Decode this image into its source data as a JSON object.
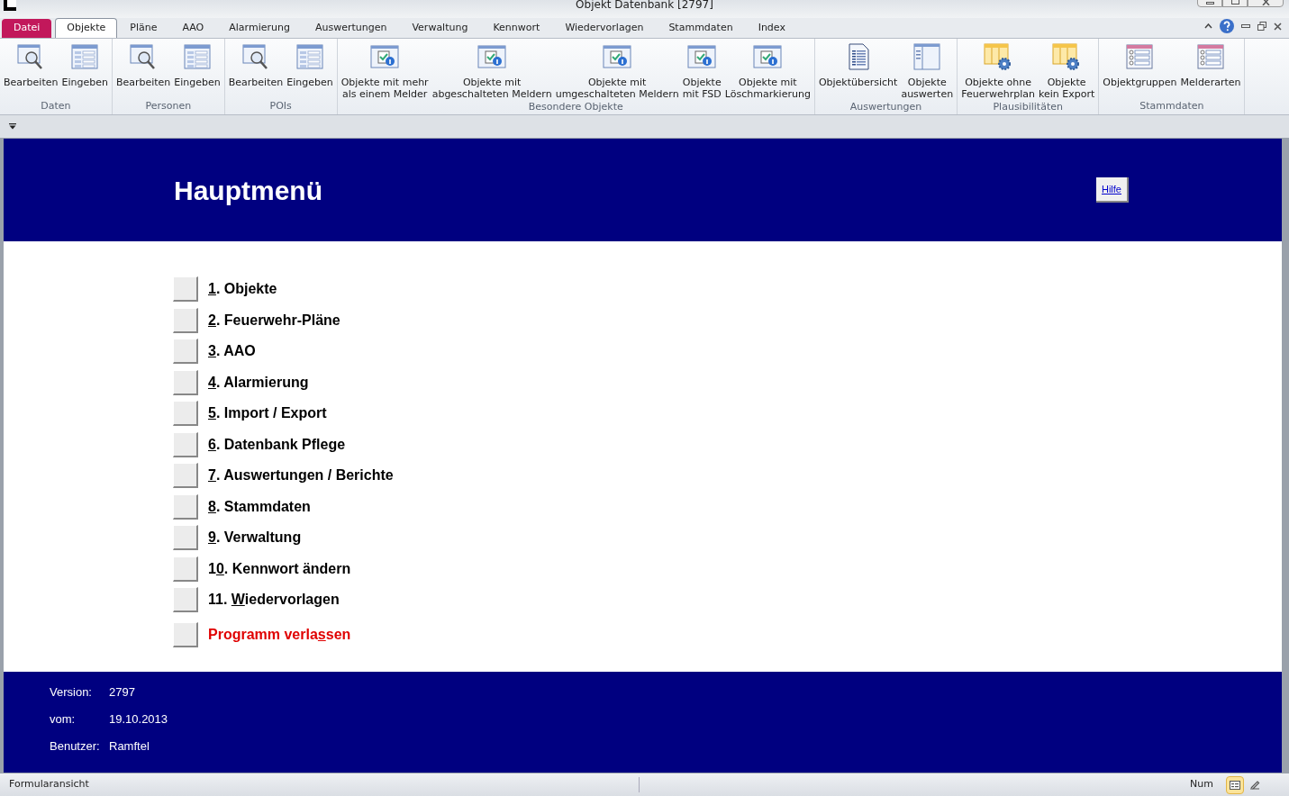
{
  "window": {
    "title": "Objekt Datenbank [2797]"
  },
  "tabs": [
    {
      "label": "Datei",
      "kind": "file"
    },
    {
      "label": "Objekte",
      "kind": "tab",
      "selected": true
    },
    {
      "label": "Pläne",
      "kind": "tab",
      "selected": false
    },
    {
      "label": "AAO",
      "kind": "tab",
      "selected": false
    },
    {
      "label": "Alarmierung",
      "kind": "tab",
      "selected": false
    },
    {
      "label": "Auswertungen",
      "kind": "tab",
      "selected": false
    },
    {
      "label": "Verwaltung",
      "kind": "tab",
      "selected": false
    },
    {
      "label": "Kennwort",
      "kind": "tab",
      "selected": false
    },
    {
      "label": "Wiedervorlagen",
      "kind": "tab",
      "selected": false
    },
    {
      "label": "Stammdaten",
      "kind": "tab",
      "selected": false
    },
    {
      "label": "Index",
      "kind": "tab",
      "selected": false
    }
  ],
  "ribbon": [
    {
      "name": "Daten",
      "buttons": [
        {
          "kind": "search",
          "lines": [
            "Bearbeiten"
          ]
        },
        {
          "kind": "form",
          "lines": [
            "Eingeben"
          ]
        }
      ]
    },
    {
      "name": "Personen",
      "buttons": [
        {
          "kind": "search",
          "lines": [
            "Bearbeiten"
          ]
        },
        {
          "kind": "form",
          "lines": [
            "Eingeben"
          ]
        }
      ]
    },
    {
      "name": "POIs",
      "buttons": [
        {
          "kind": "search",
          "lines": [
            "Bearbeiten"
          ]
        },
        {
          "kind": "form",
          "lines": [
            "Eingeben"
          ]
        }
      ]
    },
    {
      "name": "Besondere Objekte",
      "buttons": [
        {
          "kind": "info",
          "lines": [
            "Objekte mit mehr",
            "als einem Melder"
          ]
        },
        {
          "kind": "info",
          "lines": [
            "Objekte mit",
            "abgeschalteten Meldern"
          ]
        },
        {
          "kind": "info",
          "lines": [
            "Objekte mit",
            "umgeschalteten Meldern"
          ]
        },
        {
          "kind": "info",
          "lines": [
            "Objekte",
            "mit FSD"
          ]
        },
        {
          "kind": "info",
          "lines": [
            "Objekte mit",
            "Löschmarkierung"
          ]
        }
      ]
    },
    {
      "name": "Auswertungen",
      "buttons": [
        {
          "kind": "report",
          "lines": [
            "Objektübersicht"
          ]
        },
        {
          "kind": "panel",
          "lines": [
            "Objekte",
            "auswerten"
          ]
        }
      ]
    },
    {
      "name": "Plausibilitäten",
      "buttons": [
        {
          "kind": "gear",
          "lines": [
            "Objekte ohne",
            "Feuerwehrplan"
          ]
        },
        {
          "kind": "gear",
          "lines": [
            "Objekte",
            "kein Export"
          ]
        }
      ]
    },
    {
      "name": "Stammdaten",
      "buttons": [
        {
          "kind": "people",
          "lines": [
            "Objektgruppen"
          ]
        },
        {
          "kind": "people",
          "lines": [
            "Melderarten"
          ]
        }
      ]
    }
  ],
  "header": {
    "title": "Hauptmenü",
    "help_button": "Hilfe"
  },
  "menu": [
    {
      "key": "1",
      "after": ". Objekte",
      "kind": "normal"
    },
    {
      "key": "2",
      "after": ". Feuerwehr-Pläne",
      "kind": "normal"
    },
    {
      "key": "3",
      "after": ". AAO",
      "kind": "normal"
    },
    {
      "key": "4",
      "after": ". Alarmierung",
      "kind": "normal"
    },
    {
      "key": "5",
      "after": ". Import / Export",
      "kind": "normal"
    },
    {
      "key": "6",
      "after": ". Datenbank Pflege",
      "kind": "normal"
    },
    {
      "key": "7",
      "after": ". Auswertungen / Berichte",
      "kind": "normal"
    },
    {
      "key": "8",
      "after": ".  Stammdaten",
      "kind": "normal"
    },
    {
      "key": "9",
      "after": ". Verwaltung",
      "kind": "normal"
    },
    {
      "before": "1",
      "key": "0",
      "after": ". Kennwort ändern",
      "kind": "normal"
    },
    {
      "before": "11. ",
      "key": "W",
      "after": "iedervorlagen",
      "kind": "normal"
    },
    {
      "before": "Programm verla",
      "key": "s",
      "after": "sen",
      "kind": "exit"
    }
  ],
  "footer": [
    {
      "label": "Version:",
      "value": "2797"
    },
    {
      "label": "vom:",
      "value": "19.10.2013"
    },
    {
      "label": "Benutzer:",
      "value": "Ramftel"
    }
  ],
  "status_bar": {
    "text": "Formularansicht",
    "indicator": "Num",
    "views": [
      {
        "kind": "form",
        "selected": true
      },
      {
        "kind": "design",
        "selected": false
      }
    ]
  }
}
